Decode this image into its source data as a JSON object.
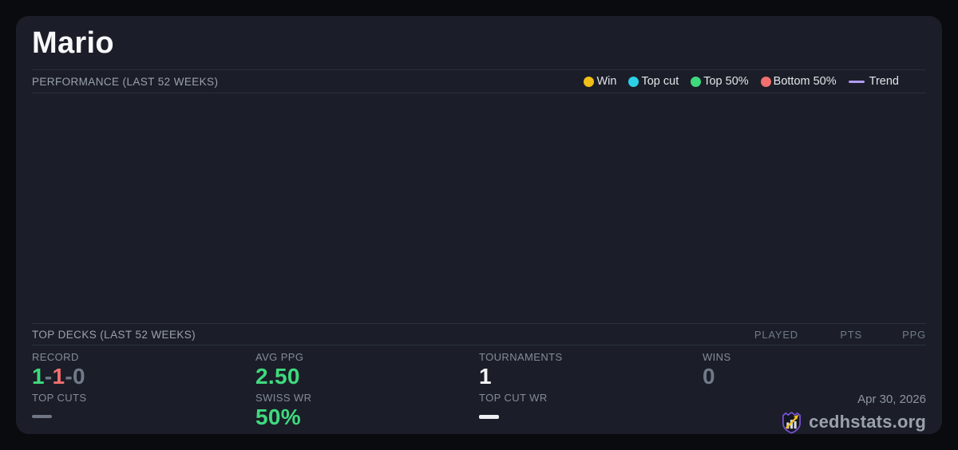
{
  "colors": {
    "page_background": "#0a0b0e",
    "card_background": "#1b1e28",
    "divider": "#2b3040",
    "win_yellow": "#f0c019",
    "topcut_cyan": "#2bd0e6",
    "top50_green": "#3fd97e",
    "bottom50_red": "#f16f6f",
    "trend_purple": "#b29bf7",
    "value_green": "#3fd97e",
    "value_red": "#f16f6f",
    "value_gray": "#717a89",
    "value_white": "#f2f3f6",
    "logo_purple": "#7a52d6",
    "logo_gold": "#f2c21d"
  },
  "player": {
    "name": "Mario"
  },
  "performance": {
    "title": "PERFORMANCE (LAST 52 WEEKS)",
    "legend": [
      {
        "label": "Win",
        "marker": "dot",
        "color": "#f0c019"
      },
      {
        "label": "Top cut",
        "marker": "dot",
        "color": "#2bd0e6"
      },
      {
        "label": "Top 50%",
        "marker": "dot",
        "color": "#3fd97e"
      },
      {
        "label": "Bottom 50%",
        "marker": "dot",
        "color": "#f16f6f"
      },
      {
        "label": "Trend",
        "marker": "line",
        "color": "#b29bf7"
      }
    ],
    "chart": {
      "type": "scatter",
      "points": [],
      "note": "chart area rendered empty - no data points visible"
    }
  },
  "top_decks": {
    "title": "TOP DECKS (LAST 52 WEEKS)",
    "columns": [
      "PLAYED",
      "PTS",
      "PPG"
    ],
    "rows": []
  },
  "stats": {
    "record": {
      "label": "RECORD",
      "wins": "1",
      "losses": "1",
      "draws": "0",
      "sep": "-"
    },
    "avg_ppg": {
      "label": "AVG PPG",
      "value": "2.50"
    },
    "tournaments": {
      "label": "TOURNAMENTS",
      "value": "1"
    },
    "wins": {
      "label": "WINS",
      "value": "0"
    },
    "top_cuts": {
      "label": "TOP CUTS",
      "value": ""
    },
    "swiss_wr": {
      "label": "SWISS WR",
      "value": "50%"
    },
    "top_cut_wr": {
      "label": "TOP CUT WR",
      "value": ""
    }
  },
  "footer": {
    "date": "Apr 30, 2026",
    "brand": "cedhstats.org"
  }
}
